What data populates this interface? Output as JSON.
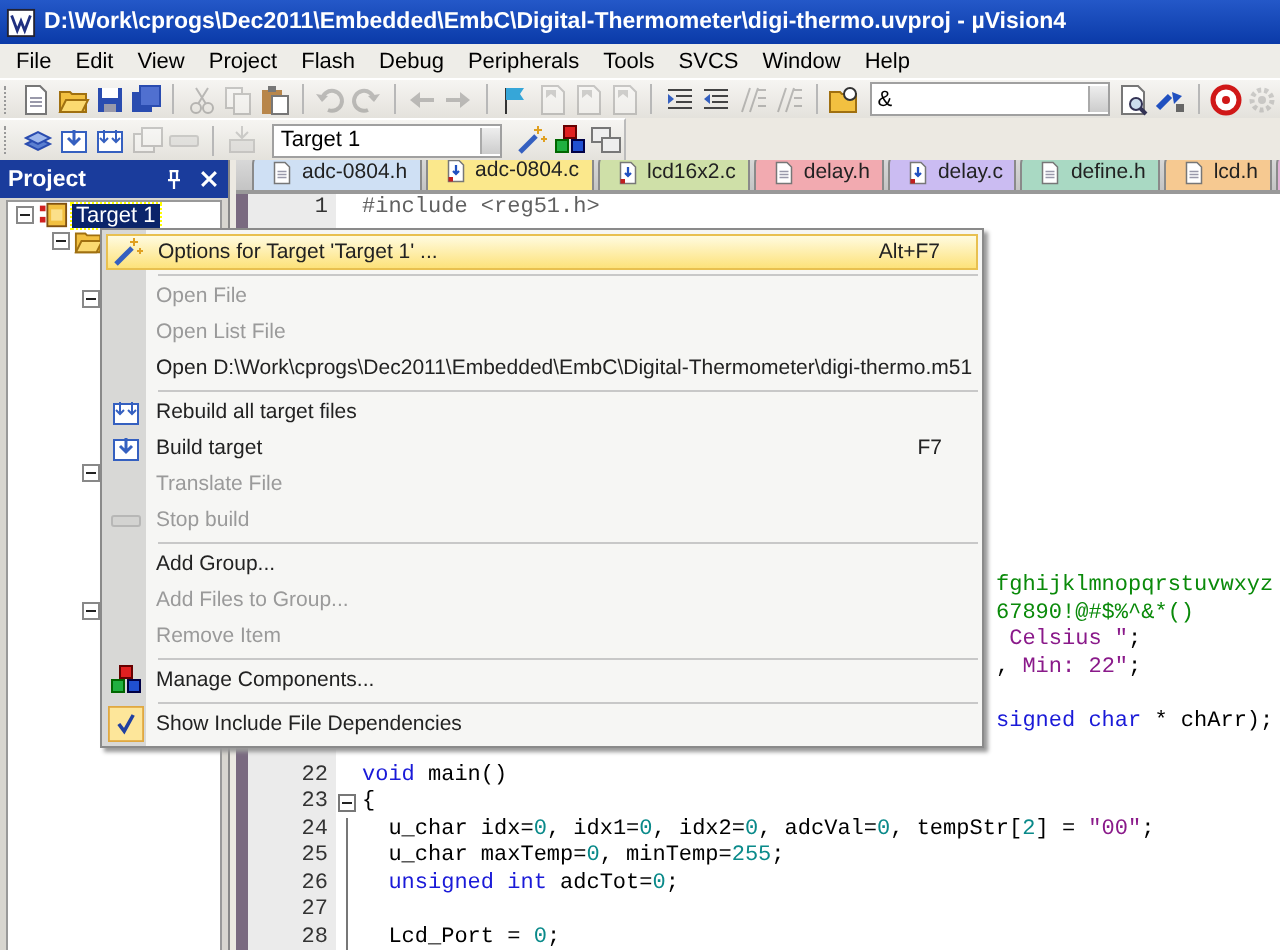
{
  "window": {
    "title": "D:\\Work\\cprogs\\Dec2011\\Embedded\\EmbC\\Digital-Thermometer\\digi-thermo.uvproj - µVision4"
  },
  "menu_bar": [
    "File",
    "Edit",
    "View",
    "Project",
    "Flash",
    "Debug",
    "Peripherals",
    "Tools",
    "SVCS",
    "Window",
    "Help"
  ],
  "toolbar_1": [
    {
      "kind": "button",
      "disabled": false
    },
    {
      "kind": "button",
      "disabled": false
    },
    {
      "kind": "button",
      "disabled": false
    },
    {
      "kind": "button",
      "disabled": false
    },
    {
      "kind": "separator"
    },
    {
      "kind": "button",
      "disabled": true
    },
    {
      "kind": "button",
      "disabled": true
    },
    {
      "kind": "button",
      "disabled": false
    },
    {
      "kind": "separator"
    },
    {
      "kind": "button",
      "disabled": true
    },
    {
      "kind": "button",
      "disabled": true
    },
    {
      "kind": "separator"
    },
    {
      "kind": "button",
      "disabled": true
    },
    {
      "kind": "button",
      "disabled": true
    },
    {
      "kind": "separator"
    },
    {
      "kind": "button",
      "disabled": false
    },
    {
      "kind": "button",
      "disabled": true
    },
    {
      "kind": "button",
      "disabled": true
    },
    {
      "kind": "button",
      "disabled": true
    },
    {
      "kind": "separator"
    },
    {
      "kind": "button",
      "disabled": false
    },
    {
      "kind": "button",
      "disabled": false
    },
    {
      "kind": "button",
      "disabled": true
    },
    {
      "kind": "button",
      "disabled": true
    },
    {
      "kind": "separator"
    },
    {
      "kind": "button",
      "disabled": false
    },
    {
      "kind": "combo",
      "value": "&"
    },
    {
      "kind": "button",
      "disabled": false
    },
    {
      "kind": "button",
      "disabled": false
    },
    {
      "kind": "separator"
    },
    {
      "kind": "button",
      "disabled": false
    },
    {
      "kind": "button",
      "disabled": true
    }
  ],
  "toolbar_2": [
    {
      "kind": "button",
      "disabled": false
    },
    {
      "kind": "button",
      "disabled": false
    },
    {
      "kind": "button",
      "disabled": false
    },
    {
      "kind": "button",
      "disabled": true
    },
    {
      "kind": "button",
      "disabled": true
    },
    {
      "kind": "separator"
    },
    {
      "kind": "button",
      "disabled": true
    },
    {
      "kind": "combo",
      "value": "Target 1"
    },
    {
      "kind": "button",
      "disabled": false
    },
    {
      "kind": "button",
      "disabled": false
    },
    {
      "kind": "button",
      "disabled": false
    }
  ],
  "project_panel": {
    "title": "Project",
    "tree": [
      {
        "label": "Target 1",
        "selected": true,
        "expanded": true,
        "children": [
          {
            "expanded": true,
            "children": [
              {
                "expanded": true
              },
              {
                "expanded": true
              },
              {
                "expanded": true
              }
            ]
          }
        ]
      }
    ]
  },
  "tabs": [
    {
      "label": "adc-0804.h",
      "kind": "header",
      "color": "#cfe0f4",
      "selected": false
    },
    {
      "label": "adc-0804.c",
      "kind": "source",
      "color": "#fbe88c",
      "selected": true
    },
    {
      "label": "lcd16x2.c",
      "kind": "source",
      "color": "#cfe0a8",
      "selected": false
    },
    {
      "label": "delay.h",
      "kind": "header",
      "color": "#f2aab0",
      "selected": false
    },
    {
      "label": "delay.c",
      "kind": "source",
      "color": "#cbbcf2",
      "selected": false
    },
    {
      "label": "define.h",
      "kind": "header",
      "color": "#a9d9c3",
      "selected": false
    },
    {
      "label": "lcd.h",
      "kind": "header",
      "color": "#f6c991",
      "selected": false
    },
    {
      "kind": "partial",
      "color": "#e2b2d6",
      "selected": false
    }
  ],
  "editor": {
    "lines": [
      {
        "kind": "code",
        "number": "1",
        "segments": [
          {
            "text": "#include <reg51.h>",
            "kind": "preprocessor"
          }
        ]
      },
      {
        "kind": "covered"
      },
      {
        "kind": "covered"
      },
      {
        "kind": "covered"
      },
      {
        "kind": "covered"
      },
      {
        "kind": "covered"
      },
      {
        "kind": "covered"
      },
      {
        "kind": "covered"
      },
      {
        "kind": "covered"
      },
      {
        "kind": "covered"
      },
      {
        "kind": "covered"
      },
      {
        "kind": "covered"
      },
      {
        "kind": "covered"
      },
      {
        "kind": "covered"
      },
      {
        "kind": "clipped",
        "segments": [
          {
            "text": "fghijklmnopqrstuvwxyz",
            "kind": "comment"
          }
        ]
      },
      {
        "kind": "clipped",
        "segments": [
          {
            "text": "67890!@#$%^&*()",
            "kind": "comment"
          }
        ]
      },
      {
        "kind": "clipped",
        "segments": [
          {
            "text": " Celsius \"",
            "kind": "string"
          },
          {
            "text": ";",
            "kind": "plain"
          }
        ]
      },
      {
        "kind": "clipped",
        "segments": [
          {
            "text": ",",
            "kind": "plain"
          },
          {
            "text": " Min: 22\"",
            "kind": "string"
          },
          {
            "text": ";",
            "kind": "plain"
          }
        ]
      },
      {
        "kind": "covered"
      },
      {
        "kind": "clipped",
        "segments": [
          {
            "text": "signed char",
            "kind": "keyword"
          },
          {
            "text": " * chArr);",
            "kind": "plain"
          }
        ]
      },
      {
        "kind": "covered"
      },
      {
        "kind": "code",
        "number": "22",
        "segments": [
          {
            "text": "void",
            "kind": "keyword"
          },
          {
            "text": " main()",
            "kind": "plain"
          }
        ]
      },
      {
        "kind": "code",
        "number": "23",
        "fold_start": true,
        "segments": [
          {
            "text": "{",
            "kind": "plain"
          }
        ]
      },
      {
        "kind": "code",
        "number": "24",
        "in_fold": true,
        "segments": [
          {
            "text": "  u_char idx=",
            "kind": "plain"
          },
          {
            "text": "0",
            "kind": "number"
          },
          {
            "text": ", idx1=",
            "kind": "plain"
          },
          {
            "text": "0",
            "kind": "number"
          },
          {
            "text": ", idx2=",
            "kind": "plain"
          },
          {
            "text": "0",
            "kind": "number"
          },
          {
            "text": ", adcVal=",
            "kind": "plain"
          },
          {
            "text": "0",
            "kind": "number"
          },
          {
            "text": ", tempStr[",
            "kind": "plain"
          },
          {
            "text": "2",
            "kind": "number"
          },
          {
            "text": "] = ",
            "kind": "plain"
          },
          {
            "text": "\"00\"",
            "kind": "string"
          },
          {
            "text": ";",
            "kind": "plain"
          }
        ]
      },
      {
        "kind": "code",
        "number": "25",
        "in_fold": true,
        "segments": [
          {
            "text": "  u_char maxTemp=",
            "kind": "plain"
          },
          {
            "text": "0",
            "kind": "number"
          },
          {
            "text": ", minTemp=",
            "kind": "plain"
          },
          {
            "text": "255",
            "kind": "number"
          },
          {
            "text": ";",
            "kind": "plain"
          }
        ]
      },
      {
        "kind": "code",
        "number": "26",
        "in_fold": true,
        "segments": [
          {
            "text": "  unsigned int",
            "kind": "keyword"
          },
          {
            "text": " adcTot=",
            "kind": "plain"
          },
          {
            "text": "0",
            "kind": "number"
          },
          {
            "text": ";",
            "kind": "plain"
          }
        ]
      },
      {
        "kind": "code",
        "number": "27",
        "in_fold": true
      },
      {
        "kind": "code",
        "number": "28",
        "in_fold": true,
        "segments": [
          {
            "text": "  Lcd_Port = ",
            "kind": "plain"
          },
          {
            "text": "0",
            "kind": "number"
          },
          {
            "text": ";",
            "kind": "plain"
          }
        ]
      }
    ]
  },
  "context_menu": {
    "items": [
      {
        "kind": "item",
        "label": "Options for Target 'Target 1' ...",
        "shortcut": "Alt+F7",
        "selected": true,
        "disabled": false
      },
      {
        "kind": "separator"
      },
      {
        "kind": "item",
        "label": "Open File",
        "selected": false,
        "disabled": true
      },
      {
        "kind": "item",
        "label": "Open List File",
        "selected": false,
        "disabled": true
      },
      {
        "kind": "item",
        "label": "Open D:\\Work\\cprogs\\Dec2011\\Embedded\\EmbC\\Digital-Thermometer\\digi-thermo.m51",
        "selected": false,
        "disabled": false
      },
      {
        "kind": "separator"
      },
      {
        "kind": "item",
        "label": "Rebuild all target files",
        "selected": false,
        "disabled": false
      },
      {
        "kind": "item",
        "label": "Build target",
        "shortcut": "F7",
        "selected": false,
        "disabled": false
      },
      {
        "kind": "item",
        "label": "Translate File",
        "selected": false,
        "disabled": true
      },
      {
        "kind": "item",
        "label": "Stop build",
        "selected": false,
        "disabled": true
      },
      {
        "kind": "separator"
      },
      {
        "kind": "item",
        "label": "Add Group...",
        "selected": false,
        "disabled": false
      },
      {
        "kind": "item",
        "label": "Add Files to Group...",
        "selected": false,
        "disabled": true
      },
      {
        "kind": "item",
        "label": "Remove Item",
        "selected": false,
        "disabled": true
      },
      {
        "kind": "separator"
      },
      {
        "kind": "item",
        "label": "Manage Components...",
        "selected": false,
        "disabled": false
      },
      {
        "kind": "separator"
      },
      {
        "kind": "item",
        "label": "Show Include File Dependencies",
        "selected": false,
        "disabled": false,
        "checked": true
      }
    ]
  }
}
